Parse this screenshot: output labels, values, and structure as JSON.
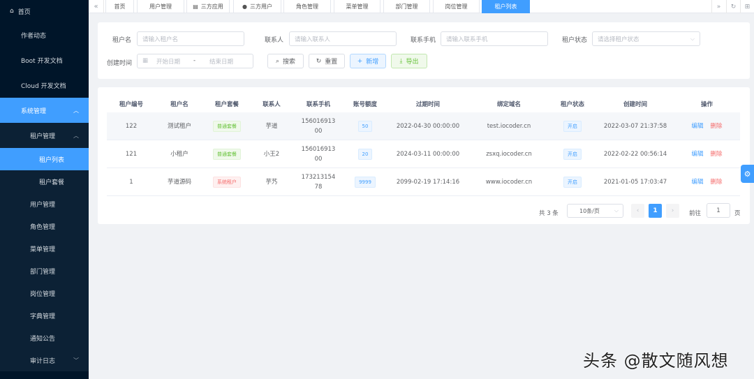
{
  "sidebar": {
    "home": "首页",
    "items": [
      "作者动态",
      "Boot 开发文档",
      "Cloud 开发文档"
    ],
    "system": "系统管理",
    "tenant_group": "租户管理",
    "tenant_list": "租户列表",
    "tenant_package": "租户套餐",
    "others": [
      "用户管理",
      "角色管理",
      "菜单管理",
      "部门管理",
      "岗位管理",
      "字典管理",
      "通知公告"
    ],
    "audit": "审计日志"
  },
  "tabs": [
    "首页",
    "用户管理",
    "三方应用",
    "三方用户",
    "角色管理",
    "菜单管理",
    "部门管理",
    "岗位管理",
    "租户列表"
  ],
  "search": {
    "tenant_name_label": "租户名",
    "tenant_name_placeholder": "请输入租户名",
    "contact_label": "联系人",
    "contact_placeholder": "请输入联系人",
    "phone_label": "联系手机",
    "phone_placeholder": "请输入联系手机",
    "status_label": "租户状态",
    "status_placeholder": "请选择租户状态",
    "created_label": "创建时间",
    "start_date": "开始日期",
    "date_sep": "-",
    "end_date": "结束日期",
    "search_btn": "搜索",
    "reset_btn": "重置",
    "add_btn": "新增",
    "export_btn": "导出"
  },
  "table": {
    "columns": [
      "租户编号",
      "租户名",
      "租户套餐",
      "联系人",
      "联系手机",
      "账号额度",
      "过期时间",
      "绑定域名",
      "租户状态",
      "创建时间",
      "操作"
    ],
    "rows": [
      {
        "id": "122",
        "name": "测试租户",
        "package": "普通套餐",
        "contact": "芋道",
        "phone1": "156016913",
        "phone2": "00",
        "quota": "50",
        "expire": "2022-04-30 00:00:00",
        "domain": "test.iocoder.cn",
        "status": "开启",
        "created": "2022-03-07 21:37:58"
      },
      {
        "id": "121",
        "name": "小租户",
        "package": "普通套餐",
        "contact": "小王2",
        "phone1": "156016913",
        "phone2": "00",
        "quota": "20",
        "expire": "2024-03-11 00:00:00",
        "domain": "zsxq.iocoder.cn",
        "status": "开启",
        "created": "2022-02-22 00:56:14"
      },
      {
        "id": "1",
        "name": "芋道源码",
        "package": "系统租户",
        "contact": "芋艿",
        "phone1": "173213154",
        "phone2": "78",
        "quota": "9999",
        "expire": "2099-02-19 17:14:16",
        "domain": "www.iocoder.cn",
        "status": "开启",
        "created": "2021-01-05 17:03:47"
      }
    ],
    "edit": "编辑",
    "delete": "删除"
  },
  "pagination": {
    "total": "共 3 条",
    "page_size": "10条/页",
    "current": "1",
    "goto_prefix": "前往",
    "goto_value": "1",
    "goto_suffix": "页"
  },
  "watermark": "头条 @散文随风想",
  "colors": {
    "primary": "#409eff",
    "sidebar": "#001529",
    "danger": "#f56c6c",
    "success": "#67c23a"
  }
}
